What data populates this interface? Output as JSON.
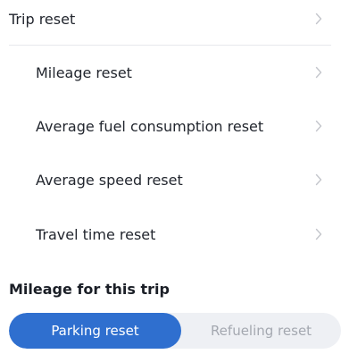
{
  "trip_reset": {
    "label": "Trip reset",
    "icon": "chevron-right-icon"
  },
  "reset_items": [
    {
      "label": "Mileage reset",
      "icon": "chevron-right-icon"
    },
    {
      "label": "Average fuel consumption reset",
      "icon": "chevron-right-icon"
    },
    {
      "label": "Average speed reset",
      "icon": "chevron-right-icon"
    },
    {
      "label": "Travel time reset",
      "icon": "chevron-right-icon"
    }
  ],
  "mileage_section": {
    "title": "Mileage for this trip"
  },
  "segmented_control": {
    "options": [
      "Parking reset",
      "Refueling reset"
    ],
    "selected": "Parking reset"
  },
  "colors": {
    "accent": "#2f6fcf",
    "segment_background": "#eef0f4",
    "inactive_text": "#a4a8b0",
    "chevron": "#c4c6cc",
    "divider": "#e7e8ec"
  }
}
